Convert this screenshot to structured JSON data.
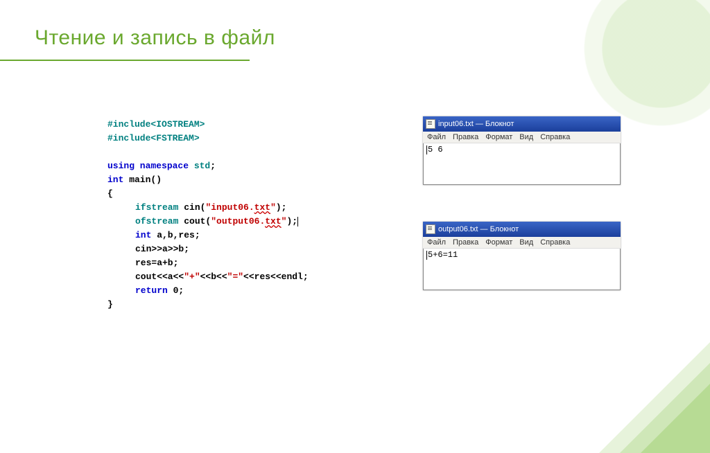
{
  "slide": {
    "title": "Чтение и запись в файл"
  },
  "code": {
    "line1a": "#include",
    "line1b": "<IOSTREAM>",
    "line2a": "#include",
    "line2b": "<FSTREAM>",
    "line3a": "using namespace ",
    "line3b": "std",
    "line3c": ";",
    "line4a": "int",
    "line4b": " main()",
    "line5": "{",
    "line6a": "ifstream",
    "line6b": " cin(",
    "line6c": "\"input06.",
    "line6d": "txt",
    "line6e": "\"",
    "line6f": ");",
    "line7a": "ofstream",
    "line7b": " cout(",
    "line7c": "\"output06.",
    "line7d": "txt",
    "line7e": "\"",
    "line7f": ");",
    "line8a": "int",
    "line8b": " a,b,res;",
    "line9": "cin>>a>>b;",
    "line10": "res=a+b;",
    "line11a": "cout<<a<<",
    "line11b": "\"+\"",
    "line11c": "<<b<<",
    "line11d": "\"=\"",
    "line11e": "<<res<<endl;",
    "line12a": "return",
    "line12b": " 0;",
    "line13": "}"
  },
  "notepad1": {
    "title": "input06.txt — Блокнот",
    "menu": {
      "file": "Файл",
      "edit": "Правка",
      "format": "Формат",
      "view": "Вид",
      "help": "Справка"
    },
    "content": "5 6"
  },
  "notepad2": {
    "title": "output06.txt — Блокнот",
    "menu": {
      "file": "Файл",
      "edit": "Правка",
      "format": "Формат",
      "view": "Вид",
      "help": "Справка"
    },
    "content": "5+6=11"
  }
}
